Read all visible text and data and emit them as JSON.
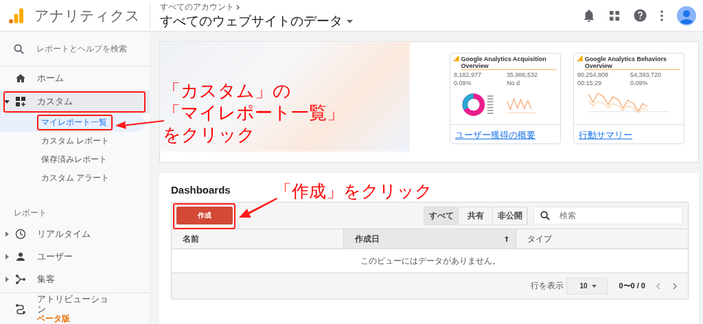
{
  "header": {
    "app_name": "アナリティクス",
    "breadcrumb": "すべてのアカウント",
    "property": "すべてのウェブサイトのデータ"
  },
  "sidebar": {
    "search_placeholder": "レポートとヘルプを検索",
    "items": [
      {
        "kind": "link",
        "label": "ホーム",
        "selected": false
      },
      {
        "kind": "group",
        "label": "カスタム",
        "expanded": true,
        "selected": true,
        "children": [
          {
            "label": "マイレポート一覧",
            "selected": true
          },
          {
            "label": "カスタム レポート",
            "selected": false
          },
          {
            "label": "保存済みレポート",
            "selected": false
          },
          {
            "label": "カスタム アラート",
            "selected": false
          }
        ]
      }
    ],
    "section_label": "レポート",
    "report_items": [
      {
        "kind": "group",
        "label": "リアルタイム",
        "expanded": false
      },
      {
        "kind": "group",
        "label": "ユーザー",
        "expanded": false
      },
      {
        "kind": "group",
        "label": "集客",
        "expanded": false
      },
      {
        "kind": "link",
        "label": "アトリビューション",
        "badge": "ベータ版"
      }
    ]
  },
  "report_cards": [
    {
      "kind": "blurred"
    },
    {
      "kind": "preview",
      "title": "Google Analytics Acquisition Overview",
      "stats": [
        "8,182,977",
        "35,986,532",
        "0.09%",
        "No d"
      ],
      "link": "ユーザー獲得の概要"
    },
    {
      "kind": "preview",
      "title": "Google Analytics Behaviors Overview",
      "stats": [
        "90,254,808",
        "54,393,720",
        "00:15:29",
        "0.09%"
      ],
      "link": "行動サマリー"
    }
  ],
  "dashboards": {
    "title": "Dashboards",
    "create_button": "作成",
    "filters": [
      {
        "label": "すべて",
        "selected": true
      },
      {
        "label": "共有",
        "selected": false
      },
      {
        "label": "非公開",
        "selected": false
      }
    ],
    "search_placeholder": "検索",
    "columns": [
      {
        "label": "名前",
        "sorted": false
      },
      {
        "label": "作成日",
        "sorted": true
      },
      {
        "label": "タイプ",
        "sorted": false
      }
    ],
    "empty_message": "このビューにはデータがありません。",
    "rows_label": "行を表示",
    "page_size": "10",
    "range": "0〜0 / 0"
  },
  "callouts": [
    {
      "lines": [
        "「カスタム」の",
        "「マイレポート一覧」",
        "をクリック"
      ]
    },
    {
      "lines": [
        "「作成」をクリック"
      ]
    }
  ]
}
